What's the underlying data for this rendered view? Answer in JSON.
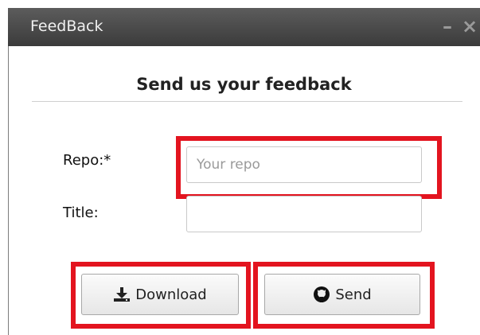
{
  "window": {
    "title": "FeedBack",
    "minimize_glyph": "–",
    "close_glyph": "×"
  },
  "form": {
    "heading": "Send us your feedback",
    "repo_label": "Repo:*",
    "repo_placeholder": "Your repo",
    "repo_value": "",
    "title_label": "Title:",
    "title_value": ""
  },
  "buttons": {
    "download_label": "Download",
    "send_label": "Send",
    "download_icon": "download-icon",
    "send_icon": "github-icon"
  },
  "colors": {
    "highlight": "#e3141f",
    "titlebar": "#4a4a4a"
  }
}
